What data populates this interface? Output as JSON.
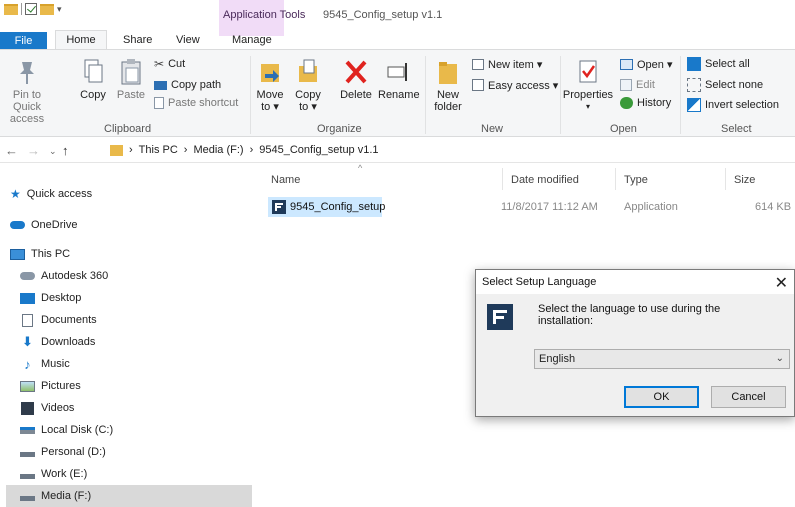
{
  "titlebar": {
    "context_tab": "Application Tools",
    "window_title": "9545_Config_setup v1.1"
  },
  "tabs": {
    "file": "File",
    "home": "Home",
    "share": "Share",
    "view": "View",
    "manage": "Manage"
  },
  "ribbon": {
    "clipboard": {
      "label": "Clipboard",
      "pin": "Pin to Quick access",
      "copy": "Copy",
      "paste": "Paste",
      "cut": "Cut",
      "copy_path": "Copy path",
      "paste_shortcut": "Paste shortcut"
    },
    "organize": {
      "label": "Organize",
      "move_to": "Move to",
      "copy_to": "Copy to",
      "delete": "Delete",
      "rename": "Rename"
    },
    "new": {
      "label": "New",
      "new_folder": "New folder",
      "new_item": "New item",
      "easy_access": "Easy access"
    },
    "open": {
      "label": "Open",
      "properties": "Properties",
      "open": "Open",
      "edit": "Edit",
      "history": "History"
    },
    "select": {
      "label": "Select",
      "select_all": "Select all",
      "select_none": "Select none",
      "invert": "Invert selection"
    }
  },
  "address": {
    "crumbs": [
      "This PC",
      "Media (F:)",
      "9545_Config_setup v1.1"
    ]
  },
  "sidebar": {
    "items": [
      {
        "label": "Quick access"
      },
      {
        "label": "OneDrive"
      },
      {
        "label": "This PC"
      },
      {
        "label": "Autodesk 360"
      },
      {
        "label": "Desktop"
      },
      {
        "label": "Documents"
      },
      {
        "label": "Downloads"
      },
      {
        "label": "Music"
      },
      {
        "label": "Pictures"
      },
      {
        "label": "Videos"
      },
      {
        "label": "Local Disk (C:)"
      },
      {
        "label": "Personal (D:)"
      },
      {
        "label": "Work (E:)"
      },
      {
        "label": "Media (F:)"
      }
    ]
  },
  "filelist": {
    "columns": {
      "name": "Name",
      "date": "Date modified",
      "type": "Type",
      "size": "Size"
    },
    "rows": [
      {
        "name": "9545_Config_setup",
        "date": "11/8/2017 11:12 AM",
        "type": "Application",
        "size": "614 KB"
      }
    ]
  },
  "dialog": {
    "title": "Select Setup Language",
    "close": "✕",
    "message": "Select the language to use during the installation:",
    "selected_language": "English",
    "ok": "OK",
    "cancel": "Cancel"
  }
}
